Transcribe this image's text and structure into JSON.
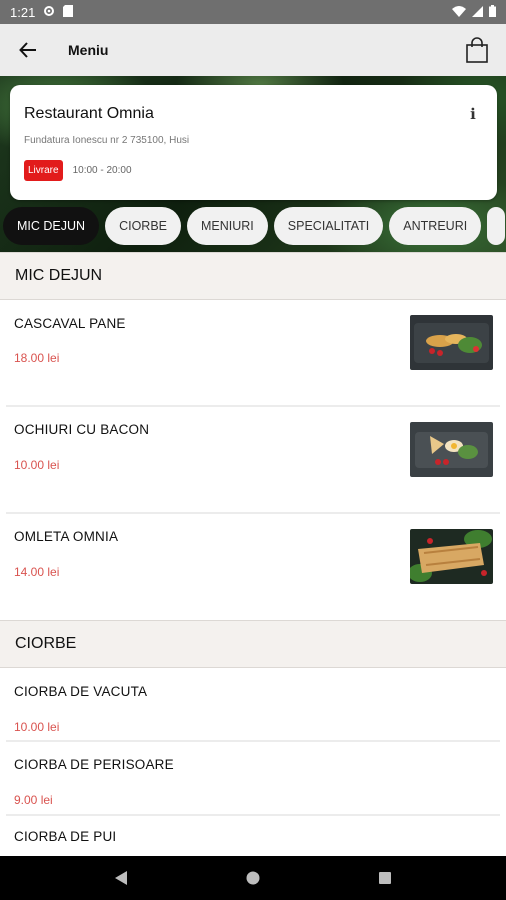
{
  "status_bar": {
    "time": "1:21"
  },
  "header": {
    "title": "Meniu"
  },
  "restaurant": {
    "name": "Restaurant Omnia",
    "address": "Fundatura Ionescu nr 2 735100, Husi",
    "badge": "Livrare",
    "hours": "10:00 - 20:00"
  },
  "tabs": [
    "MIC DEJUN",
    "CIORBE",
    "MENIURI",
    "SPECIALITATI",
    "ANTREURI"
  ],
  "sections": [
    {
      "title": "MIC DEJUN",
      "items": [
        {
          "name": "CASCAVAL PANE",
          "price": "18.00 lei"
        },
        {
          "name": "OCHIURI CU BACON",
          "price": "10.00 lei"
        },
        {
          "name": "OMLETA OMNIA",
          "price": "14.00 lei"
        }
      ]
    },
    {
      "title": "CIORBE",
      "items": [
        {
          "name": "CIORBA DE VACUTA",
          "price": "10.00 lei"
        },
        {
          "name": "CIORBA DE PERISOARE",
          "price": "9.00 lei"
        },
        {
          "name": "CIORBA DE PUI"
        }
      ]
    }
  ],
  "colors": {
    "accent": "#e21b1b",
    "price": "#d9534f",
    "active_tab": "#111111"
  }
}
